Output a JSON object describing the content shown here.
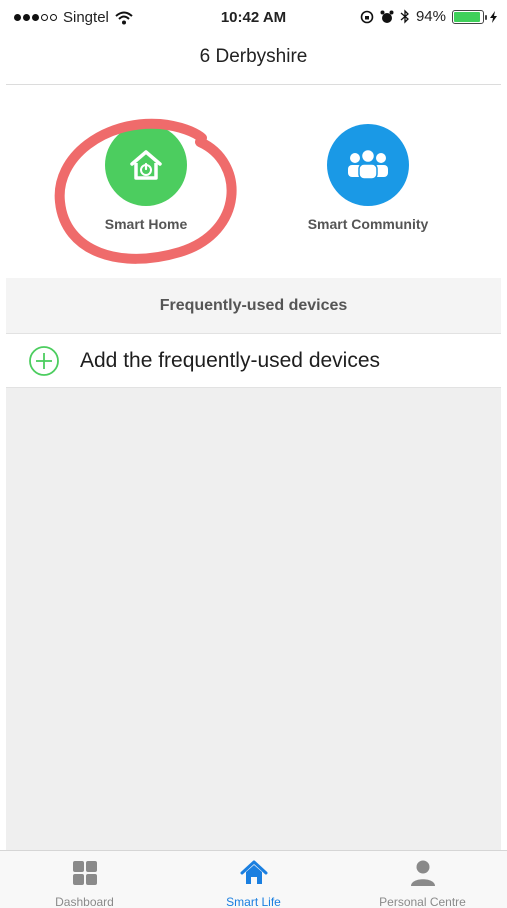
{
  "status_bar": {
    "carrier": "Singtel",
    "time": "10:42 AM",
    "battery_percent": "94%",
    "battery_level": 0.94
  },
  "header": {
    "title": "6 Derbyshire"
  },
  "features": [
    {
      "label": "Smart Home",
      "icon": "smart-home-icon",
      "color": "#4ccd5f"
    },
    {
      "label": "Smart Community",
      "icon": "community-icon",
      "color": "#1a99e6"
    }
  ],
  "frequent_devices": {
    "section_title": "Frequently-used devices",
    "add_label": "Add the frequently-used devices"
  },
  "tab_bar": {
    "tabs": [
      {
        "label": "Dashboard",
        "icon": "dashboard-icon",
        "active": false
      },
      {
        "label": "Smart Life",
        "icon": "home-icon",
        "active": true
      },
      {
        "label": "Personal Centre",
        "icon": "person-icon",
        "active": false
      }
    ]
  },
  "colors": {
    "accent": "#1a7fe0",
    "annotation": "#ef6b6b"
  }
}
